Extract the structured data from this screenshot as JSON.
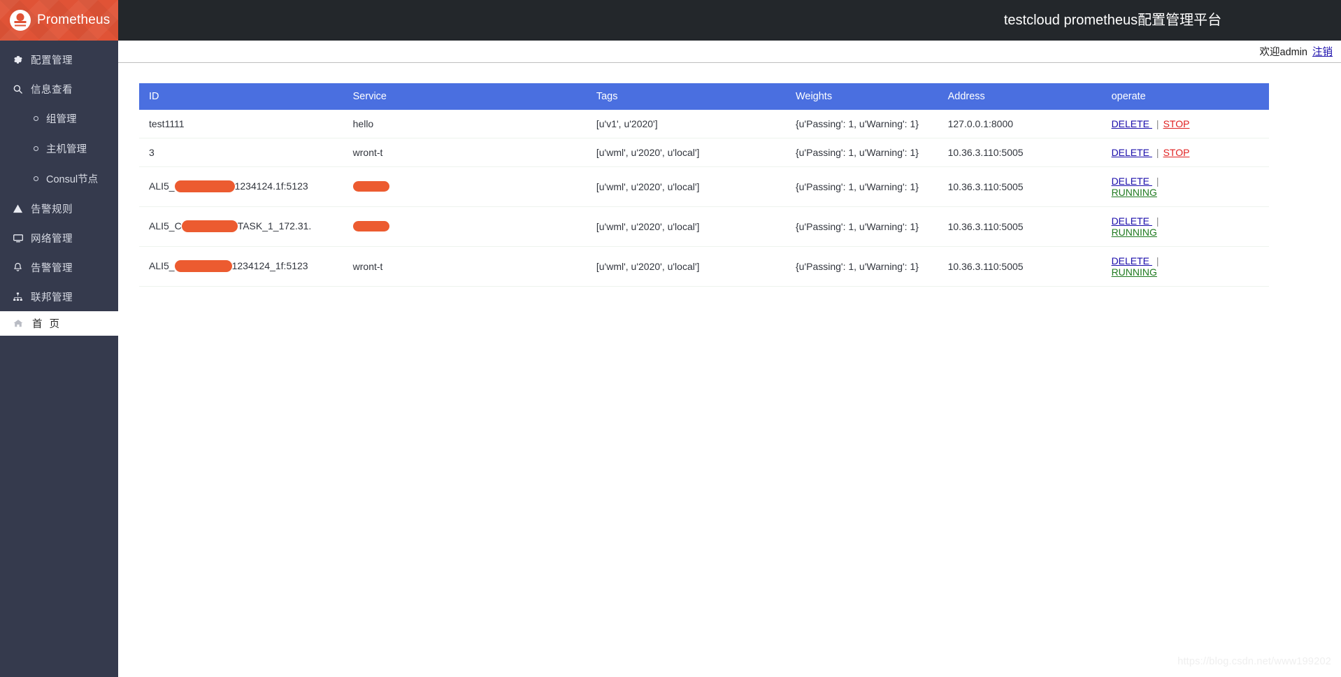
{
  "brand": {
    "name": "Prometheus",
    "logo_icon": "prometheus-logo-icon"
  },
  "header": {
    "title": "testcloud prometheus配置管理平台",
    "welcome_text": "欢迎admin",
    "logout_label": "注销"
  },
  "sidebar": {
    "items": [
      {
        "label": "配置管理",
        "icon": "gear-icon",
        "type": "item",
        "key": "config-management"
      },
      {
        "label": "信息查看",
        "icon": "search-icon",
        "type": "item",
        "key": "info-view"
      },
      {
        "label": "组管理",
        "icon": "bullet-icon",
        "type": "sub",
        "key": "group-management"
      },
      {
        "label": "主机管理",
        "icon": "bullet-icon",
        "type": "sub",
        "key": "host-management"
      },
      {
        "label": "Consul节点",
        "icon": "bullet-icon",
        "type": "sub",
        "key": "consul-node"
      },
      {
        "label": "告警规则",
        "icon": "warning-triangle-icon",
        "type": "item",
        "key": "alert-rules"
      },
      {
        "label": "网络管理",
        "icon": "monitor-icon",
        "type": "item",
        "key": "network-management"
      },
      {
        "label": "告警管理",
        "icon": "bell-icon",
        "type": "item",
        "key": "alert-management"
      },
      {
        "label": "联邦管理",
        "icon": "sitemap-icon",
        "type": "item",
        "key": "federation-management"
      }
    ],
    "home": {
      "label": "首 页",
      "icon": "home-icon",
      "key": "home"
    }
  },
  "table": {
    "columns": [
      "ID",
      "Service",
      "Tags",
      "Weights",
      "Address",
      "operate"
    ],
    "header_bg": "#4a6fe0",
    "rows": [
      {
        "id": "test1111",
        "id_redacted": false,
        "service": "hello",
        "service_redacted": false,
        "tags": "[u'v1', u'2020']",
        "weights": "{u'Passing': 1, u'Warning': 1}",
        "address": "127.0.0.1:8000",
        "actions": [
          "DELETE",
          "STOP"
        ]
      },
      {
        "id": "3",
        "id_redacted": false,
        "service": "wront-t",
        "service_redacted": false,
        "tags": "[u'wml', u'2020', u'local']",
        "weights": "{u'Passing': 1, u'Warning': 1}",
        "address": "10.36.3.110:5005",
        "actions": [
          "DELETE",
          "STOP"
        ]
      },
      {
        "id_prefix": "ALI5_",
        "id_suffix": "1234124.1f:5123",
        "id_redacted": true,
        "service": "",
        "service_redacted": true,
        "tags": "[u'wml', u'2020', u'local']",
        "weights": "{u'Passing': 1, u'Warning': 1}",
        "address": "10.36.3.110:5005",
        "actions": [
          "DELETE",
          "RUNNING"
        ]
      },
      {
        "id_prefix": "ALI5_C",
        "id_suffix": "TASK_1_172.31.",
        "id_redacted": true,
        "service": "",
        "service_redacted": true,
        "tags": "[u'wml', u'2020', u'local']",
        "weights": "{u'Passing': 1, u'Warning': 1}",
        "address": "10.36.3.110:5005",
        "actions": [
          "DELETE",
          "RUNNING"
        ]
      },
      {
        "id_prefix": "ALI5_",
        "id_suffix": "1234124_1f:5123",
        "id_redacted": true,
        "service": "wront-t",
        "service_redacted": false,
        "tags": "[u'wml', u'2020', u'local']",
        "weights": "{u'Passing': 1, u'Warning': 1}",
        "address": "10.36.3.110:5005",
        "actions": [
          "DELETE",
          "RUNNING"
        ]
      }
    ],
    "action_separator": "|"
  },
  "watermark": "https://blog.csdn.net/www199202"
}
